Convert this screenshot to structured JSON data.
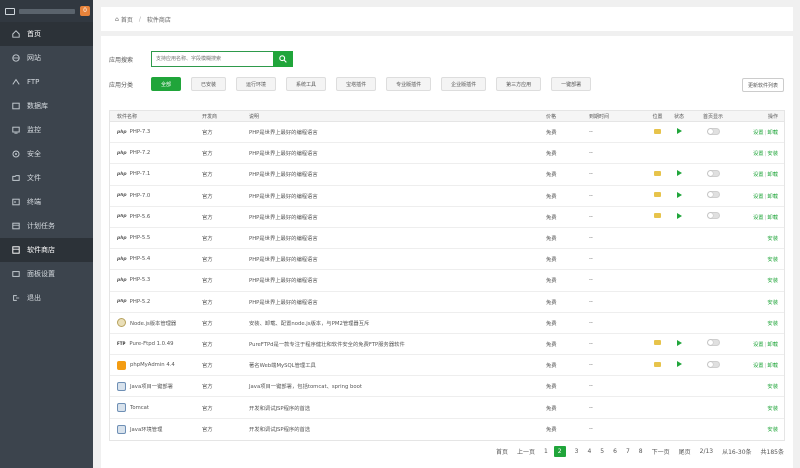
{
  "brand": {
    "badge": "0"
  },
  "sidebar": {
    "items": [
      {
        "label": "首页",
        "icon": "home-icon",
        "active": true
      },
      {
        "label": "网站",
        "icon": "globe-icon",
        "active": false
      },
      {
        "label": "FTP",
        "icon": "ftp-icon",
        "active": false
      },
      {
        "label": "数据库",
        "icon": "database-icon",
        "active": false
      },
      {
        "label": "监控",
        "icon": "monitor-icon",
        "active": false
      },
      {
        "label": "安全",
        "icon": "shield-icon",
        "active": false
      },
      {
        "label": "文件",
        "icon": "folder-icon",
        "active": false
      },
      {
        "label": "终端",
        "icon": "terminal-icon",
        "active": false
      },
      {
        "label": "计划任务",
        "icon": "clock-icon",
        "active": false
      },
      {
        "label": "软件商店",
        "icon": "store-icon",
        "active": true
      },
      {
        "label": "面板设置",
        "icon": "settings-icon",
        "active": false
      },
      {
        "label": "退出",
        "icon": "logout-icon",
        "active": false
      }
    ]
  },
  "breadcrumb": {
    "home": "首页",
    "separator": "/",
    "current": "软件商店"
  },
  "search": {
    "label": "应用搜索",
    "placeholder": "支持应用名称、字段模糊搜索"
  },
  "categories": {
    "label": "应用分类",
    "items": [
      "全部",
      "已安装",
      "运行环境",
      "系统工具",
      "宝塔插件",
      "专业版插件",
      "企业版插件",
      "第三方应用",
      "一键部署"
    ],
    "active_index": 0
  },
  "update_list_label": "更新软件列表",
  "table": {
    "headers": {
      "name": "软件名称",
      "dev": "开发商",
      "desc": "说明",
      "price": "价格",
      "expire": "到期时间",
      "location": "位置",
      "status": "状态",
      "home": "首页显示",
      "op": "操作"
    },
    "rows": [
      {
        "icon": "php",
        "name": "PHP-7.3",
        "dev": "官方",
        "desc": "PHP是世界上最好的编程语言",
        "price": "免费",
        "expire": "--",
        "installed": true,
        "op": [
          "设置",
          "卸载"
        ]
      },
      {
        "icon": "php",
        "name": "PHP-7.2",
        "dev": "官方",
        "desc": "PHP是世界上最好的编程语言",
        "price": "免费",
        "expire": "--",
        "installed": false,
        "op": [
          "设置",
          "安装"
        ]
      },
      {
        "icon": "php",
        "name": "PHP-7.1",
        "dev": "官方",
        "desc": "PHP是世界上最好的编程语言",
        "price": "免费",
        "expire": "--",
        "installed": true,
        "op": [
          "设置",
          "卸载"
        ]
      },
      {
        "icon": "php",
        "name": "PHP-7.0",
        "dev": "官方",
        "desc": "PHP是世界上最好的编程语言",
        "price": "免费",
        "expire": "--",
        "installed": true,
        "op": [
          "设置",
          "卸载"
        ]
      },
      {
        "icon": "php",
        "name": "PHP-5.6",
        "dev": "官方",
        "desc": "PHP是世界上最好的编程语言",
        "price": "免费",
        "expire": "--",
        "installed": true,
        "op": [
          "设置",
          "卸载"
        ]
      },
      {
        "icon": "php",
        "name": "PHP-5.5",
        "dev": "官方",
        "desc": "PHP是世界上最好的编程语言",
        "price": "免费",
        "expire": "--",
        "installed": false,
        "op": [
          "安装"
        ]
      },
      {
        "icon": "php",
        "name": "PHP-5.4",
        "dev": "官方",
        "desc": "PHP是世界上最好的编程语言",
        "price": "免费",
        "expire": "--",
        "installed": false,
        "op": [
          "安装"
        ]
      },
      {
        "icon": "php",
        "name": "PHP-5.3",
        "dev": "官方",
        "desc": "PHP是世界上最好的编程语言",
        "price": "免费",
        "expire": "--",
        "installed": false,
        "op": [
          "安装"
        ]
      },
      {
        "icon": "php",
        "name": "PHP-5.2",
        "dev": "官方",
        "desc": "PHP是世界上最好的编程语言",
        "price": "免费",
        "expire": "--",
        "installed": false,
        "op": [
          "安装"
        ]
      },
      {
        "icon": "node",
        "name": "Node.js版本管理器",
        "dev": "官方",
        "desc": "安装、卸载、配置node.js版本，与PM2管理器互斥",
        "price": "免费",
        "expire": "--",
        "installed": false,
        "op": [
          "安装"
        ]
      },
      {
        "icon": "ftp",
        "name": "Pure-Ftpd 1.0.49",
        "dev": "官方",
        "desc": "PureFTPd是一款专注于程序健壮和软件安全的免费FTP服务器软件",
        "price": "免费",
        "expire": "--",
        "installed": true,
        "op": [
          "设置",
          "卸载"
        ]
      },
      {
        "icon": "pma",
        "name": "phpMyAdmin 4.4",
        "dev": "官方",
        "desc": "著名Web端MySQL管理工具",
        "price": "免费",
        "expire": "--",
        "installed": true,
        "op": [
          "设置",
          "卸载"
        ]
      },
      {
        "icon": "java",
        "name": "Java项目一键部署",
        "dev": "官方",
        "desc": "Java项目一键部署，包括tomcat、spring boot",
        "price": "免费",
        "expire": "--",
        "installed": false,
        "op": [
          "安装"
        ]
      },
      {
        "icon": "java",
        "name": "Tomcat",
        "dev": "官方",
        "desc": "开发和调试JSP程序的首选",
        "price": "免费",
        "expire": "--",
        "installed": false,
        "op": [
          "安装"
        ]
      },
      {
        "icon": "java",
        "name": "Java环境管理",
        "dev": "官方",
        "desc": "开发和调试JSP程序的首选",
        "price": "免费",
        "expire": "--",
        "installed": false,
        "op": [
          "安装"
        ]
      }
    ]
  },
  "pagination": {
    "first": "首页",
    "prev": "上一页",
    "pages": [
      "1",
      "2",
      "3",
      "4",
      "5",
      "6",
      "7",
      "8"
    ],
    "current": "2",
    "next": "下一页",
    "last": "尾页",
    "page_info": "2/13",
    "range": "从16-30条",
    "total": "共185条"
  },
  "colors": {
    "accent": "#20a53a",
    "sidebar": "#3c444d"
  }
}
